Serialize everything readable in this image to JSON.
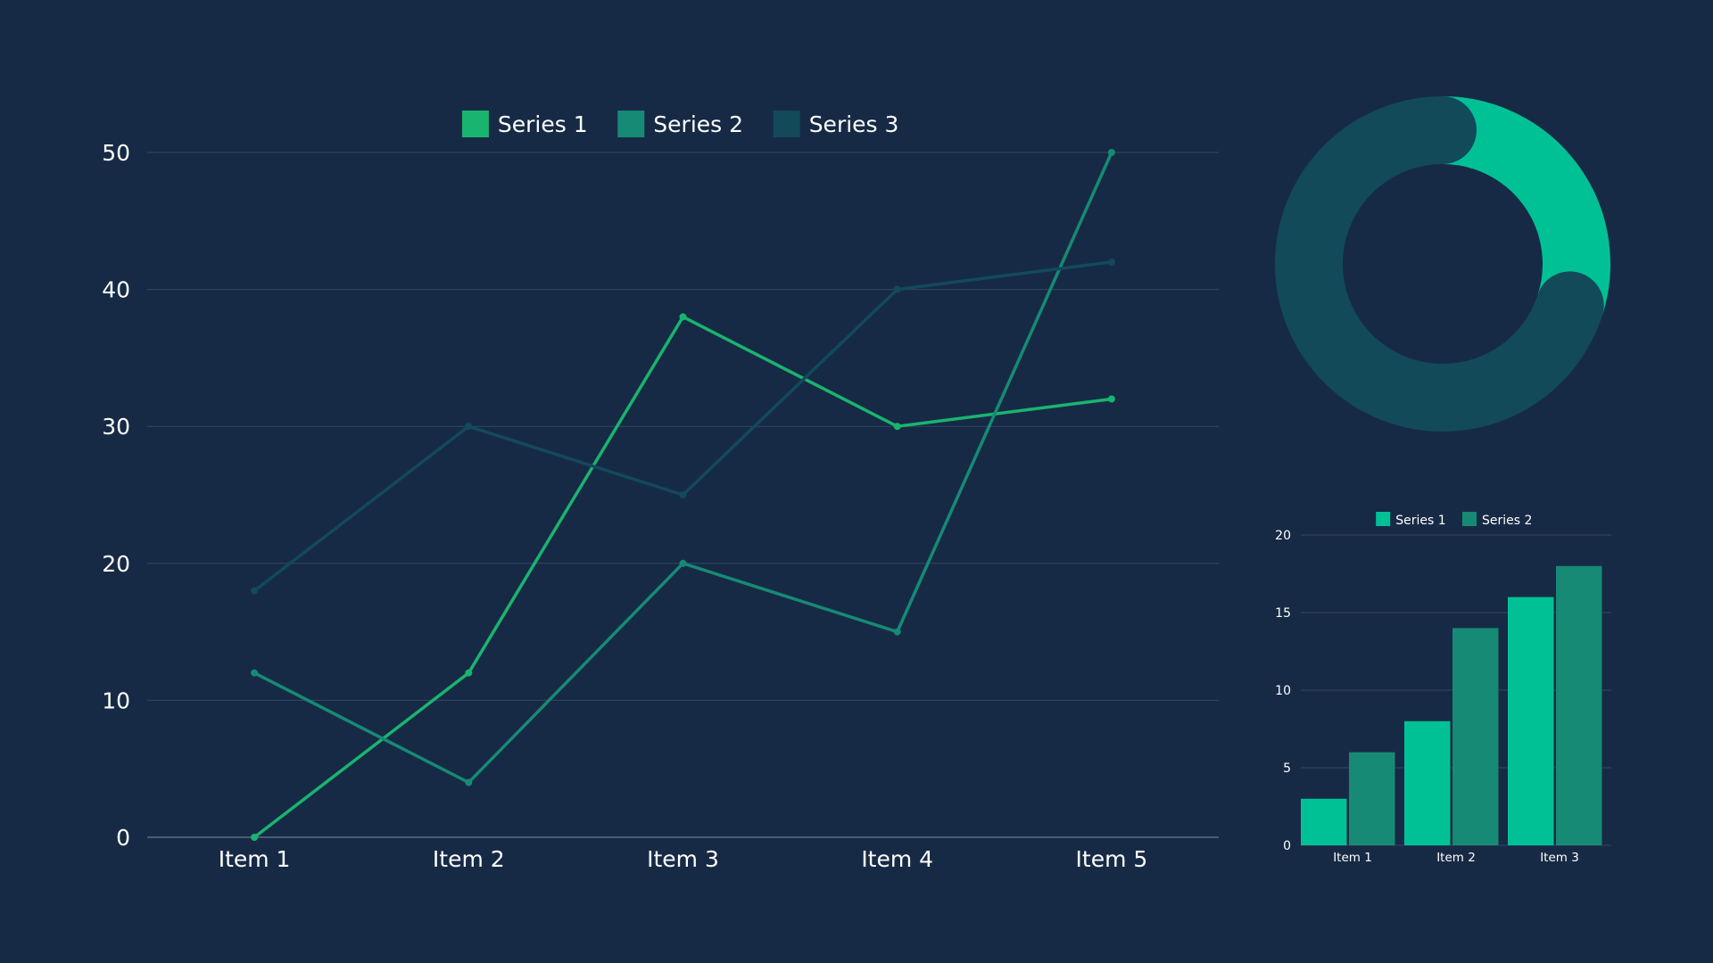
{
  "colors": {
    "background": "#172a45",
    "gridline": "#344761",
    "axis": "#5b6d85",
    "text": "#ffffff"
  },
  "chart_data": [
    {
      "type": "line",
      "categories": [
        "Item 1",
        "Item 2",
        "Item 3",
        "Item 4",
        "Item 5"
      ],
      "series": [
        {
          "name": "Series 1",
          "color": "#19b46f",
          "values": [
            0,
            12,
            38,
            30,
            32
          ]
        },
        {
          "name": "Series 2",
          "color": "#168a74",
          "values": [
            12,
            4,
            20,
            15,
            50
          ]
        },
        {
          "name": "Series 3",
          "color": "#124a5a",
          "values": [
            18,
            30,
            25,
            40,
            42
          ]
        }
      ],
      "ylim": [
        0,
        50
      ],
      "yticks": [
        0,
        10,
        20,
        30,
        40,
        50
      ],
      "grid": true,
      "legend": "top-center"
    },
    {
      "type": "pie",
      "style": "donut",
      "slices": [
        {
          "value": 30,
          "color": "#00c196"
        },
        {
          "value": 70,
          "color": "#124a5a"
        }
      ],
      "legend": "none"
    },
    {
      "type": "bar",
      "categories": [
        "Item 1",
        "Item 2",
        "Item 3"
      ],
      "series": [
        {
          "name": "Series 1",
          "color": "#00c196",
          "values": [
            3,
            8,
            16
          ]
        },
        {
          "name": "Series 2",
          "color": "#168a74",
          "values": [
            6,
            14,
            18
          ]
        }
      ],
      "ylim": [
        0,
        20
      ],
      "yticks": [
        0,
        5,
        10,
        15,
        20
      ],
      "grid": true,
      "legend": "top-center"
    }
  ]
}
